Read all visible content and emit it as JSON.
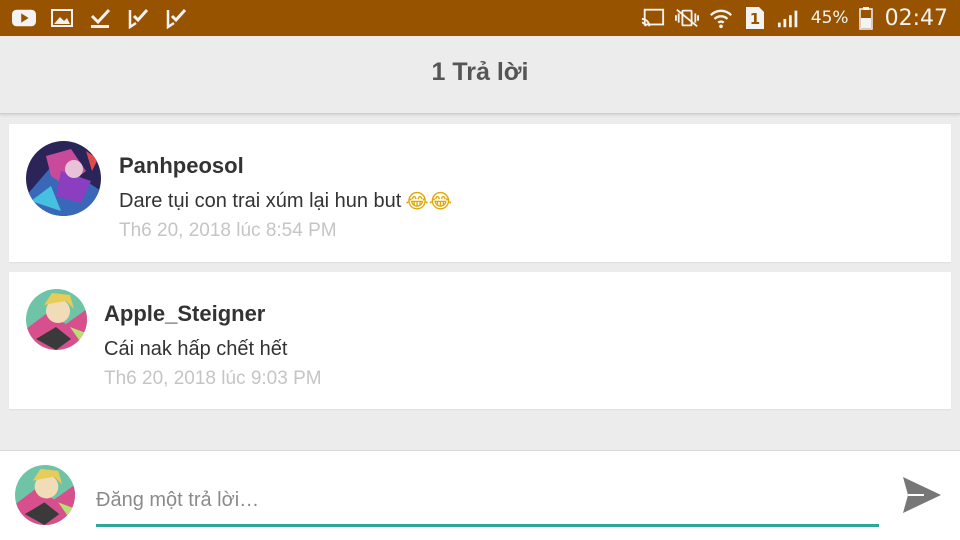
{
  "status_bar": {
    "battery_percent": "45%",
    "time": "02:47",
    "sim_slot": "1",
    "colors": {
      "background": "#975300",
      "foreground": "#f3f3f3"
    },
    "left_icons": [
      "youtube-icon",
      "image-icon",
      "download-check-icon",
      "checklist-icon",
      "checklist-icon"
    ],
    "right_icons": [
      "cast-icon",
      "vibrate-icon",
      "wifi-icon",
      "sim-icon",
      "signal-icon",
      "battery-icon"
    ]
  },
  "header": {
    "title": "1 Trả lời"
  },
  "replies": [
    {
      "author": "Panhpeosol",
      "text": "Dare tụi con trai xúm lại hun but",
      "emojis": "😂😂",
      "timestamp": "Th6 20, 2018 lúc 8:54 PM",
      "avatar_icon": "user-avatar-icon"
    },
    {
      "author": "Apple_Steigner",
      "text": "Cái nak hấp chết hết",
      "timestamp": "Th6 20, 2018 lúc 9:03 PM",
      "avatar_icon": "user-avatar-icon"
    }
  ],
  "composer": {
    "placeholder": "Đăng một trả lời…",
    "value": "",
    "accent_color": "#2fa69c",
    "send_icon": "send-icon"
  }
}
